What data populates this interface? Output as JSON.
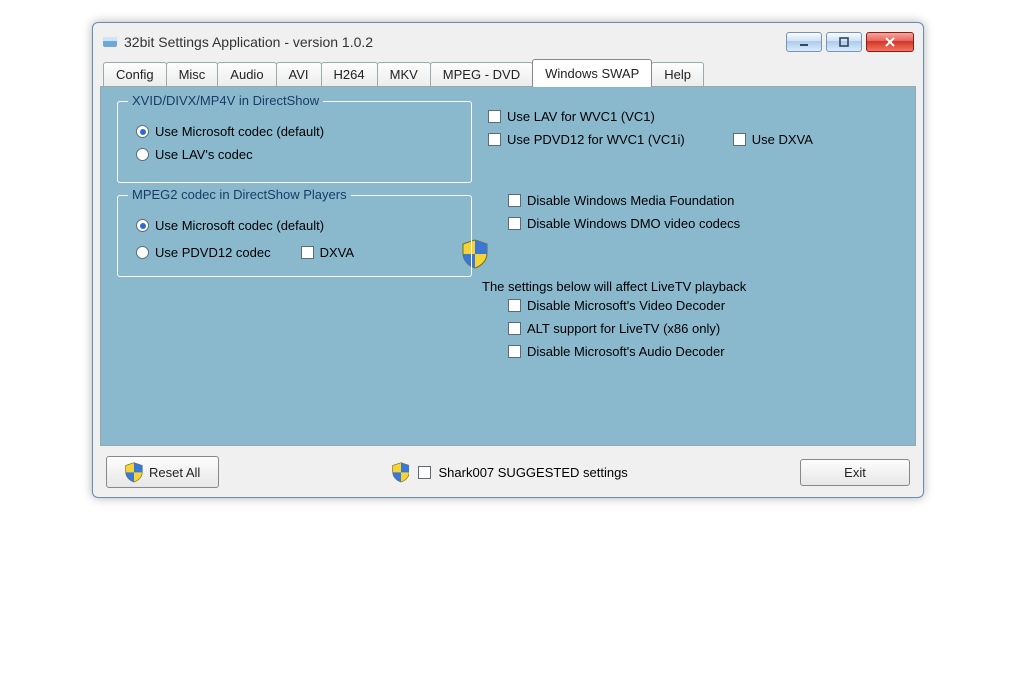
{
  "window": {
    "title": "32bit Settings Application - version 1.0.2"
  },
  "tabs": [
    {
      "label": "Config"
    },
    {
      "label": "Misc"
    },
    {
      "label": "Audio"
    },
    {
      "label": "AVI"
    },
    {
      "label": "H264"
    },
    {
      "label": "MKV"
    },
    {
      "label": "MPEG - DVD"
    },
    {
      "label": "Windows SWAP"
    },
    {
      "label": "Help"
    }
  ],
  "active_tab": 7,
  "groups": {
    "xvid": {
      "legend": "XVID/DIVX/MP4V in DirectShow",
      "opt1": "Use Microsoft codec (default)",
      "opt2": "Use LAV's codec"
    },
    "mpeg2": {
      "legend": "MPEG2 codec in DirectShow Players",
      "opt1": "Use Microsoft codec (default)",
      "opt2": "Use PDVD12 codec",
      "dxva": "DXVA"
    }
  },
  "right": {
    "lav_wvc1": "Use LAV for WVC1 (VC1)",
    "pdvd12_wvc1i": "Use PDVD12 for WVC1 (VC1i)",
    "use_dxva": "Use DXVA",
    "disable_wmf": "Disable Windows Media Foundation",
    "disable_dmo": "Disable Windows DMO video codecs",
    "livetv_label": "The settings below will affect LiveTV playback",
    "disable_ms_video": "Disable Microsoft's Video Decoder",
    "alt_livetv": "ALT support for LiveTV (x86 only)",
    "disable_ms_audio": "Disable Microsoft's Audio Decoder"
  },
  "footer": {
    "reset": "Reset All",
    "suggested": "Shark007 SUGGESTED settings",
    "exit": "Exit"
  }
}
